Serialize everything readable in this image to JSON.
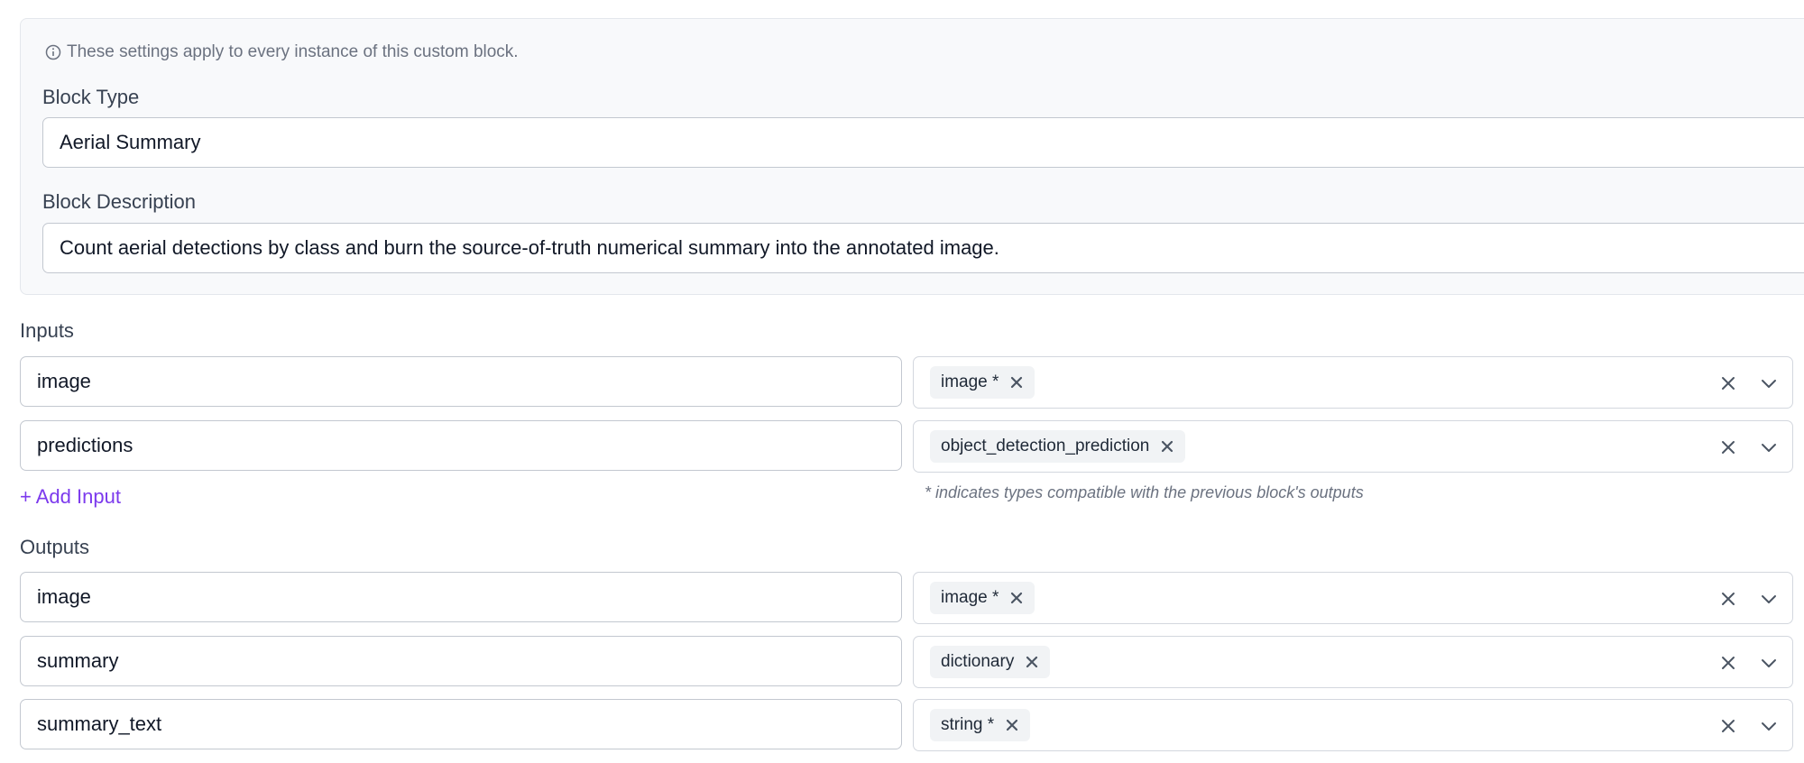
{
  "settings": {
    "info_text": "These settings apply to every instance of this custom block.",
    "block_type_label": "Block Type",
    "block_type_value": "Aerial Summary",
    "block_description_label": "Block Description",
    "block_description_value": "Count aerial detections by class and burn the source-of-truth numerical summary into the annotated image."
  },
  "inputs": {
    "label": "Inputs",
    "rows": [
      {
        "name": "image",
        "type": "image *"
      },
      {
        "name": "predictions",
        "type": "object_detection_prediction"
      }
    ],
    "add_label": "+ Add Input",
    "compat_note": "* indicates types compatible with the previous block's outputs"
  },
  "outputs": {
    "label": "Outputs",
    "rows": [
      {
        "name": "image",
        "type": "image *"
      },
      {
        "name": "summary",
        "type": "dictionary"
      },
      {
        "name": "summary_text",
        "type": "string *"
      }
    ]
  },
  "colors": {
    "accent": "#7c3aed",
    "panel_bg": "#f8f9fb",
    "chip_bg": "#f1f3f5"
  },
  "icons": {
    "info": "info-circle-icon",
    "chip_remove": "close-icon",
    "clear": "clear-x-icon",
    "dropdown": "chevron-down-icon"
  }
}
